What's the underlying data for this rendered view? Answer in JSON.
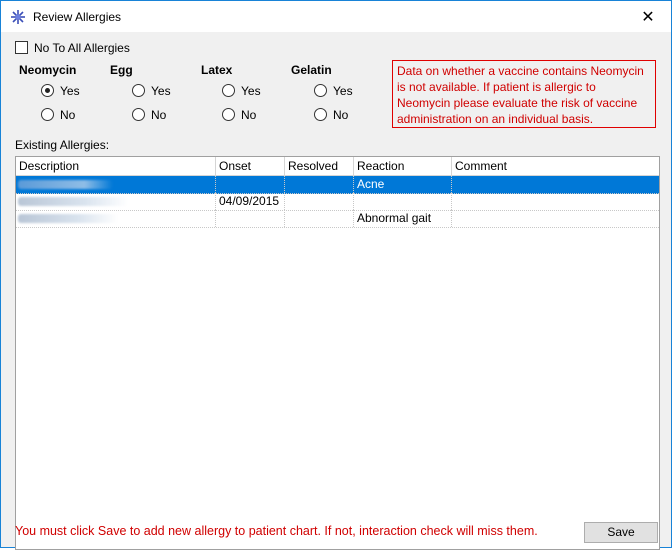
{
  "window": {
    "title": "Review Allergies",
    "close_symbol": "✕"
  },
  "no_to_all": {
    "label": "No To All Allergies",
    "checked": false
  },
  "groups": [
    {
      "title": "Neomycin",
      "yes": "Yes",
      "no": "No",
      "selected": "Yes"
    },
    {
      "title": "Egg",
      "yes": "Yes",
      "no": "No",
      "selected": ""
    },
    {
      "title": "Latex",
      "yes": "Yes",
      "no": "No",
      "selected": ""
    },
    {
      "title": "Gelatin",
      "yes": "Yes",
      "no": "No",
      "selected": ""
    }
  ],
  "warning_text": "Data on whether a vaccine contains Neomycin is not available. If patient is allergic to Neomycin please evaluate the risk of vaccine administration on an individual basis.",
  "existing_label": "Existing Allergies:",
  "table": {
    "columns": [
      "Description",
      "Onset",
      "Resolved",
      "Reaction",
      "Comment"
    ],
    "rows": [
      {
        "description": "",
        "onset": "",
        "resolved": "",
        "reaction": "Acne",
        "comment": "",
        "selected": true
      },
      {
        "description": "",
        "onset": "04/09/2015",
        "resolved": "",
        "reaction": "",
        "comment": "",
        "selected": false
      },
      {
        "description": "",
        "onset": "",
        "resolved": "",
        "reaction": "Abnormal gait",
        "comment": "",
        "selected": false
      }
    ]
  },
  "footer_message": "You must click Save to add new allergy to patient chart. If not, interaction check will miss them.",
  "save_label": "Save",
  "colors": {
    "accent": "#0078d7",
    "warning": "#d00000",
    "border": "#1883d7"
  }
}
